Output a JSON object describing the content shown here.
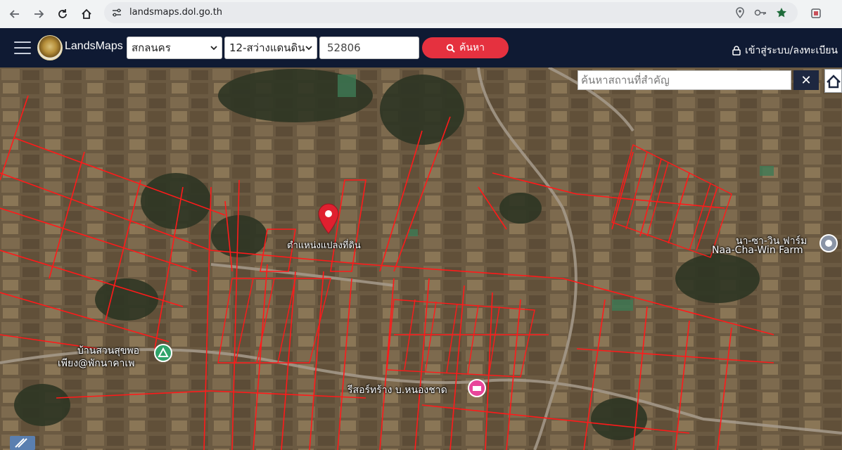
{
  "browser": {
    "url": "landsmaps.dol.go.th",
    "nav": {
      "back": "back-arrow-icon",
      "forward": "forward-arrow-icon",
      "reload": "reload-icon",
      "home": "home-icon"
    },
    "omnibox_icons": [
      "location-icon",
      "key-icon",
      "star-icon"
    ],
    "extension_icon": "extension-icon"
  },
  "header": {
    "brand": "LandsMaps",
    "province_select": "สกลนคร",
    "district_select": "12-สว่างแดนดิน",
    "parcel_input": "52806",
    "search_button": "ค้นหา",
    "login_link": "เข้าสู่ระบบ/ลงทะเบียน"
  },
  "map": {
    "place_search_placeholder": "ค้นหาสถานที่สำคัญ",
    "clear_label": "✕",
    "pin_label": "ตำแหน่งแปลงที่ดิน",
    "poi": [
      {
        "name_line1": "นา-ซา-วิน ฟาร์ม",
        "name_line2": "Naa-Cha-Win Farm"
      },
      {
        "name_line1": "บ้านสวนสุขพอ",
        "name_line2": "เพียง@พักนาคาเพ"
      },
      {
        "name_line1": "รีสอร์ทร้าง บ.หนองชาด"
      }
    ],
    "colors": {
      "parcel": "#ff1a1a",
      "pin": "#e0202f",
      "header_bg": "#0f1a33",
      "search_btn": "#e5313f"
    }
  }
}
